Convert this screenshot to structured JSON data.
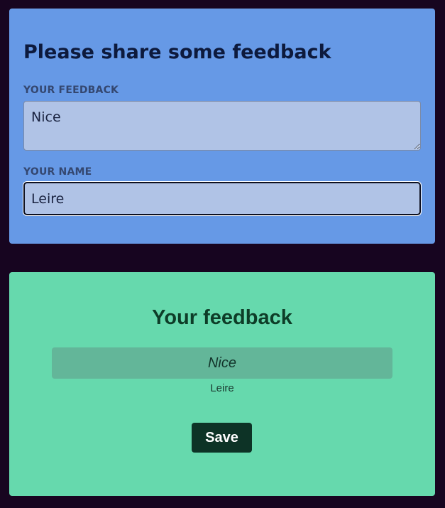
{
  "form": {
    "title": "Please share some feedback",
    "feedback_label": "YOUR FEEDBACK",
    "feedback_value": "Nice",
    "name_label": "YOUR NAME",
    "name_value": "Leire"
  },
  "result": {
    "title": "Your feedback",
    "feedback_text": "Nice",
    "author": "Leire",
    "save_label": "Save"
  },
  "colors": {
    "page_background": "#170520",
    "form_panel": "#6699e6",
    "result_panel": "#66d9ad",
    "save_button": "#0d3326"
  }
}
